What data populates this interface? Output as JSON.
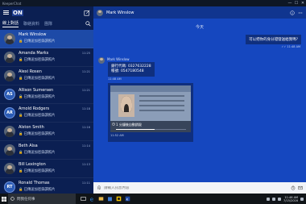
{
  "window": {
    "app_title": "KeeperChat",
    "minimize": "—",
    "maximize": "☐",
    "close": "✕"
  },
  "sidebar": {
    "logo": "ON",
    "tabs": [
      {
        "label": "線上對話",
        "active": true
      },
      {
        "label": "聯絡資料",
        "active": false
      },
      {
        "label": "團隊",
        "active": false
      }
    ],
    "conversations": [
      {
        "name": "Mark Winslow",
        "time": "",
        "message": "🔒 已傳送加密錄讀照片",
        "avatar": "photo",
        "initials": "",
        "selected": true
      },
      {
        "name": "Amanda Marks",
        "time": "11:25",
        "message": "🔒 已傳送加密錄讀照片",
        "avatar": "photo",
        "initials": "",
        "selected": false
      },
      {
        "name": "Alexi Rosen",
        "time": "11:21",
        "message": "🔒 已傳送加密錄讀照片",
        "avatar": "photo",
        "initials": "",
        "selected": false
      },
      {
        "name": "Allison Sumersen",
        "time": "11:21",
        "message": "🔒 已傳送加密錄讀照片",
        "avatar": "initials",
        "initials": "AS",
        "selected": false
      },
      {
        "name": "Arnold Rodgers",
        "time": "11:18",
        "message": "🔒 已傳送加密錄讀照片",
        "avatar": "initials",
        "initials": "AR",
        "selected": false
      },
      {
        "name": "Alston Smith",
        "time": "11:16",
        "message": "🔒 已傳送加密錄讀照片",
        "avatar": "photo",
        "initials": "",
        "selected": false
      },
      {
        "name": "Beth Alsa",
        "time": "11:14",
        "message": "🔒 已傳送加密錄讀照片",
        "avatar": "photo",
        "initials": "",
        "selected": false
      },
      {
        "name": "Bill Lexington",
        "time": "11:13",
        "message": "🔒 已傳送加密錄讀照片",
        "avatar": "photo",
        "initials": "",
        "selected": false
      },
      {
        "name": "Ronald Thomas",
        "time": "11:11",
        "message": "🔒 已傳送加密錄讀照片",
        "avatar": "initials",
        "initials": "RT",
        "selected": false
      }
    ]
  },
  "chat": {
    "contact_name": "Mark Winslow",
    "day_label": "今天",
    "outgoing": {
      "text": "可以把你的身分證發送給我嗎?",
      "time": "11:48 AM"
    },
    "incoming_sender": "Mark Winslow",
    "incoming_lines": [
      "銀行代碼: 0327632228",
      "帳號: 0547180548"
    ],
    "incoming_time": "11:48 AM",
    "image_caption": "1 分鐘後自動銷毀",
    "image_progress": 0.55,
    "image_time": "11:52 AM",
    "input_placeholder": "請輸入訊息內容"
  },
  "taskbar": {
    "search_text": "問我任何事",
    "time": "11:46 AM",
    "date": "7/15/2016"
  }
}
